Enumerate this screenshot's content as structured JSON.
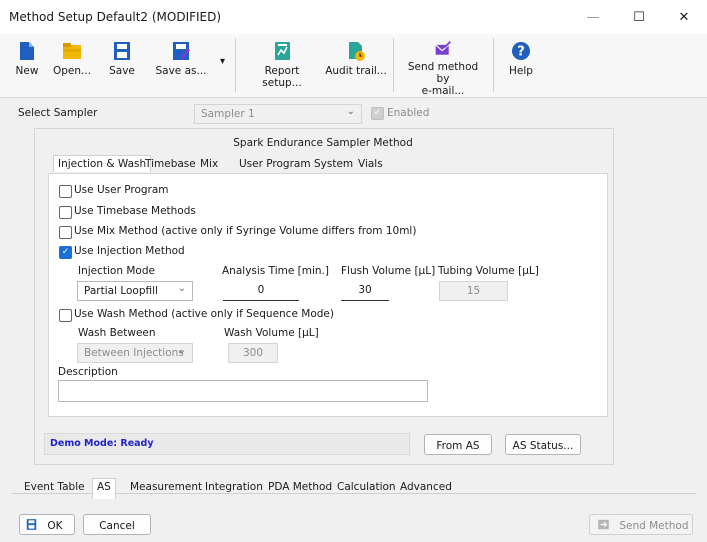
{
  "window": {
    "title": "Method Setup Default2 (MODIFIED)",
    "minimize_glyph": "—",
    "maximize_glyph": "☐",
    "close_glyph": "✕"
  },
  "toolbar": {
    "new": "New",
    "open": "Open...",
    "save": "Save",
    "save_as": "Save as...",
    "dropdown_glyph": "▾",
    "report_setup": "Report setup...",
    "audit_trail": "Audit trail...",
    "send_method_line1": "Send method by",
    "send_method_line2": "e-mail...",
    "help": "Help"
  },
  "sampler": {
    "label": "Select Sampler",
    "selected": "Sampler 1",
    "enabled_label": "Enabled",
    "enabled_checked": true
  },
  "panel": {
    "title": "Spark Endurance Sampler Method",
    "tabs": [
      "Injection & Wash",
      "Timebase",
      "Mix",
      "User Program",
      "System",
      "Vials"
    ],
    "active_tab": "Injection & Wash"
  },
  "options": {
    "use_user_program": "Use User Program",
    "use_timebase_methods": "Use Timebase Methods",
    "use_mix_method": "Use Mix Method  (active only if Syringe Volume differs from 10ml)",
    "use_injection_method": "Use Injection Method",
    "use_wash_method": "Use Wash Method  (active only if Sequence Mode)"
  },
  "injection": {
    "mode_label": "Injection Mode",
    "mode_value": "Partial Loopfill",
    "analysis_time_label": "Analysis Time [min.]",
    "analysis_time_value": "0",
    "flush_volume_label": "Flush Volume [µL]",
    "flush_volume_value": "30",
    "tubing_volume_label": "Tubing Volume [µL]",
    "tubing_volume_value": "15"
  },
  "wash": {
    "between_label": "Wash Between",
    "between_value": "Between Injections",
    "volume_label": "Wash Volume [µL]",
    "volume_value": "300"
  },
  "description": {
    "label": "Description",
    "value": ""
  },
  "status": {
    "text": "Demo Mode: Ready",
    "from_as": "From AS",
    "as_status": "AS Status..."
  },
  "bottom_tabs": [
    "Event Table",
    "AS",
    "Measurement",
    "Integration",
    "PDA Method",
    "Calculation",
    "Advanced"
  ],
  "active_bottom_tab": "AS",
  "footer": {
    "ok": "OK",
    "cancel": "Cancel",
    "send_method": "Send Method"
  },
  "colors": {
    "accent": "#1a6fd6",
    "status_text": "#2222cc",
    "disabled_text": "#8c8c8c",
    "icon_blue": "#1f5fbf",
    "icon_yellow": "#f2b705",
    "icon_teal": "#2aa59a",
    "icon_purple": "#7a3fd1"
  }
}
